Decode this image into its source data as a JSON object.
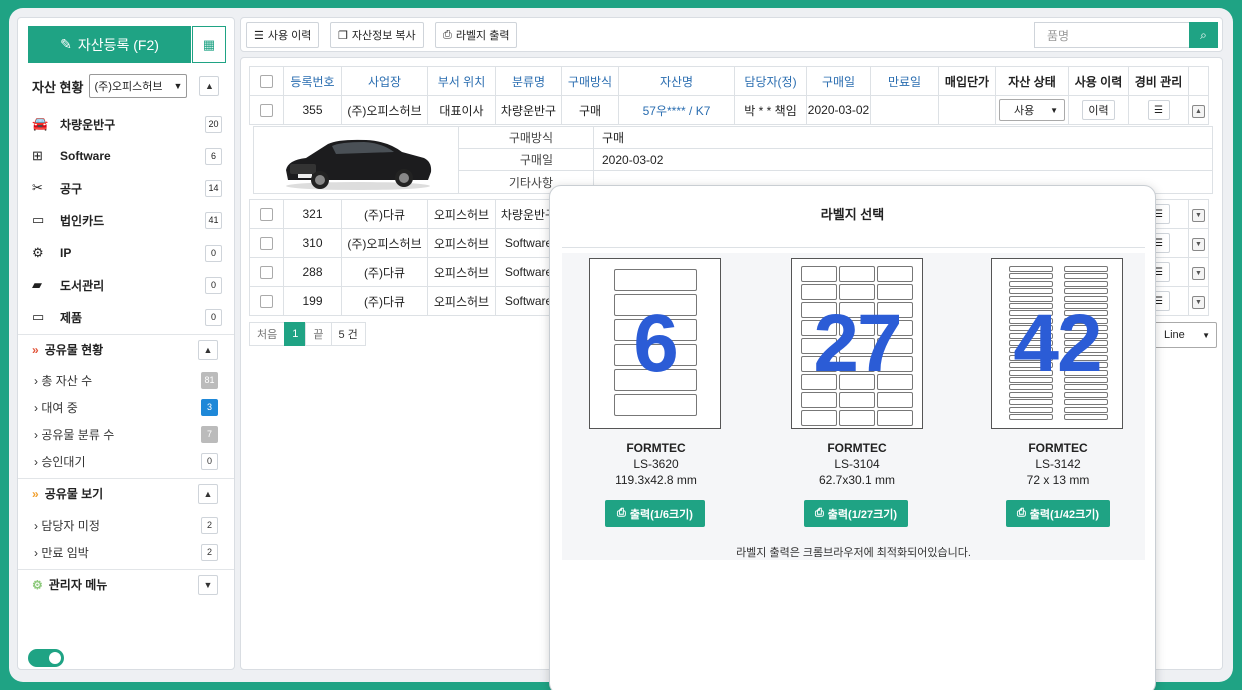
{
  "sidebar": {
    "register_label": "자산등록 (F2)",
    "status_label": "자산 현황",
    "company_select": "(주)오피스허브",
    "categories": [
      {
        "icon": "car-icon",
        "label": "차량운반구",
        "count": "20"
      },
      {
        "icon": "windows-icon",
        "label": "Software",
        "count": "6"
      },
      {
        "icon": "scissors-icon",
        "label": "공구",
        "count": "14"
      },
      {
        "icon": "credit-card-icon",
        "label": "법인카드",
        "count": "41"
      },
      {
        "icon": "cogs-icon",
        "label": "IP",
        "count": "0"
      },
      {
        "icon": "book-icon",
        "label": "도서관리",
        "count": "0"
      },
      {
        "icon": "monitor-icon",
        "label": "제품",
        "count": "0"
      }
    ],
    "shared_status_label": "공유물 현황",
    "shared_items": [
      {
        "label": "총 자산 수",
        "count": "81"
      },
      {
        "label": "대여 중",
        "count": "3"
      },
      {
        "label": "공유물 분류 수",
        "count": "7"
      },
      {
        "label": "승인대기",
        "count": "0"
      }
    ],
    "shared_view_label": "공유물 보기",
    "view_items": [
      {
        "label": "담당자 미정",
        "count": "2"
      },
      {
        "label": "만료 임박",
        "count": "2"
      }
    ],
    "admin_label": "관리자 메뉴"
  },
  "toolbar": {
    "history_label": "사용 이력",
    "copy_label": "자산정보 복사",
    "label_print": "라벨지 출력",
    "search_placeholder": "품명"
  },
  "table": {
    "headers": [
      "등록번호",
      "사업장",
      "부서 위치",
      "분류명",
      "구매방식",
      "자산명",
      "담당자(정)",
      "구매일",
      "만료일",
      "매입단가",
      "자산 상태",
      "사용 이력",
      "경비 관리"
    ],
    "first_row": {
      "no": "355",
      "site": "(주)오피스허브",
      "dept": "대표이사",
      "cat": "차량운반구",
      "buy": "구매",
      "name": "57우**** / K7",
      "owner": "박 * * 책임",
      "date": "2020-03-02",
      "status": "사용",
      "hist": "이력"
    },
    "detail": [
      {
        "k": "구매방식",
        "v": "구매"
      },
      {
        "k": "구매일",
        "v": "2020-03-02"
      },
      {
        "k": "기타사항",
        "v": ""
      }
    ],
    "rows": [
      {
        "no": "321",
        "site": "(주)다큐",
        "dept": "오피스허브",
        "cat": "차량운반구"
      },
      {
        "no": "310",
        "site": "(주)오피스허브",
        "dept": "오피스허브",
        "cat": "Software"
      },
      {
        "no": "288",
        "site": "(주)다큐",
        "dept": "오피스허브",
        "cat": "Software"
      },
      {
        "no": "199",
        "site": "(주)다큐",
        "dept": "오피스허브",
        "cat": "Software"
      }
    ]
  },
  "pager": {
    "first": "처음",
    "current": "1",
    "last": "끝",
    "total": "5 건",
    "line_select": "Line"
  },
  "modal": {
    "title": "라벨지 선택",
    "labels": [
      {
        "count": "6",
        "brand": "FORMTEC",
        "model": "LS-3620",
        "size": "119.3x42.8 mm",
        "button": "출력(1/6크기)"
      },
      {
        "count": "27",
        "brand": "FORMTEC",
        "model": "LS-3104",
        "size": "62.7x30.1 mm",
        "button": "출력(1/27크기)"
      },
      {
        "count": "42",
        "brand": "FORMTEC",
        "model": "LS-3142",
        "size": "72 x 13 mm",
        "button": "출력(1/42크기)"
      }
    ],
    "note": "라벨지 출력은 크롬브라우저에 최적화되어있습니다."
  }
}
